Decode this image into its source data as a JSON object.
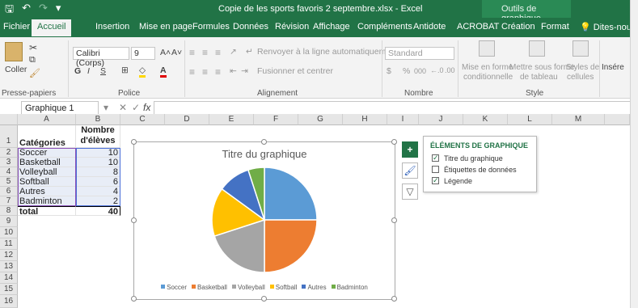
{
  "window": {
    "title": "Copie de les sports favoris 2 septembre.xlsx - Excel",
    "context_tab_group": "Outils de graphique",
    "qat": [
      "💾",
      "↶",
      "↷",
      "▾"
    ]
  },
  "tabs": [
    "Fichier",
    "Accueil",
    "Insertion",
    "Mise en page",
    "Formules",
    "Données",
    "Révision",
    "Affichage",
    "Compléments",
    "Antidote",
    "ACROBAT",
    "Création",
    "Format",
    "Dites-nou"
  ],
  "ribbon": {
    "paste": "Coller",
    "font_name": "Calibri (Corps)",
    "font_size": "9",
    "grow": "A˄",
    "shrink": "A˅",
    "bold": "G",
    "italic": "I",
    "underline": "S",
    "wrap": "Renvoyer à la ligne automatiquement",
    "merge": "Fusionner et centrer",
    "number_format": "Standard",
    "currency": "$",
    "percent": "%",
    "thousands": "000",
    "dec_inc": "⁰⁰",
    "cond_format": [
      "Mise en forme",
      "conditionnelle"
    ],
    "format_table": [
      "Mettre sous forme",
      "de tableau"
    ],
    "cell_styles": [
      "Styles de",
      "cellules"
    ],
    "insert": "Insére",
    "groups": {
      "clipboard": "Presse-papiers",
      "font": "Police",
      "alignment": "Alignement",
      "number": "Nombre",
      "style": "Style"
    }
  },
  "formula_bar": {
    "name_box": "Graphique 1",
    "fx": "fx",
    "cancel": "✕",
    "confirm": "✓",
    "value": ""
  },
  "sheet": {
    "columns": [
      "A",
      "B",
      "C",
      "D",
      "E",
      "F",
      "G",
      "H",
      "I",
      "J",
      "K",
      "L",
      "M"
    ],
    "rows": [
      [
        "Catégories",
        "Nombre d'élèves"
      ],
      [
        "Soccer",
        "10"
      ],
      [
        "Basketball",
        "10"
      ],
      [
        "Volleyball",
        "8"
      ],
      [
        "Softball",
        "6"
      ],
      [
        "Autres",
        "4"
      ],
      [
        "Badminton",
        "2"
      ],
      [
        "total",
        "40"
      ]
    ],
    "header_b_line1": "Nombre",
    "header_b_line2": "d'élèves",
    "row_numbers": [
      "1",
      "2",
      "3",
      "4",
      "5",
      "6",
      "7",
      "8",
      "9",
      "10",
      "11",
      "12",
      "13",
      "14",
      "15",
      "16"
    ]
  },
  "chart_data": {
    "type": "pie",
    "title": "Titre du graphique",
    "categories": [
      "Soccer",
      "Basketball",
      "Volleyball",
      "Softball",
      "Autres",
      "Badminton"
    ],
    "values": [
      10,
      10,
      8,
      6,
      4,
      2
    ],
    "colors": [
      "#5b9bd5",
      "#ed7d31",
      "#a5a5a5",
      "#ffc000",
      "#4472c4",
      "#70ad47"
    ],
    "legend_position": "bottom"
  },
  "chart_elements_panel": {
    "title": "ÉLÉMENTS DE GRAPHIQUE",
    "items": [
      {
        "label": "Titre du graphique",
        "checked": true
      },
      {
        "label": "Étiquettes de données",
        "checked": false
      },
      {
        "label": "Légende",
        "checked": true
      }
    ]
  },
  "side_buttons": {
    "elements": "+",
    "styles": "🖌",
    "filter": "▽"
  }
}
